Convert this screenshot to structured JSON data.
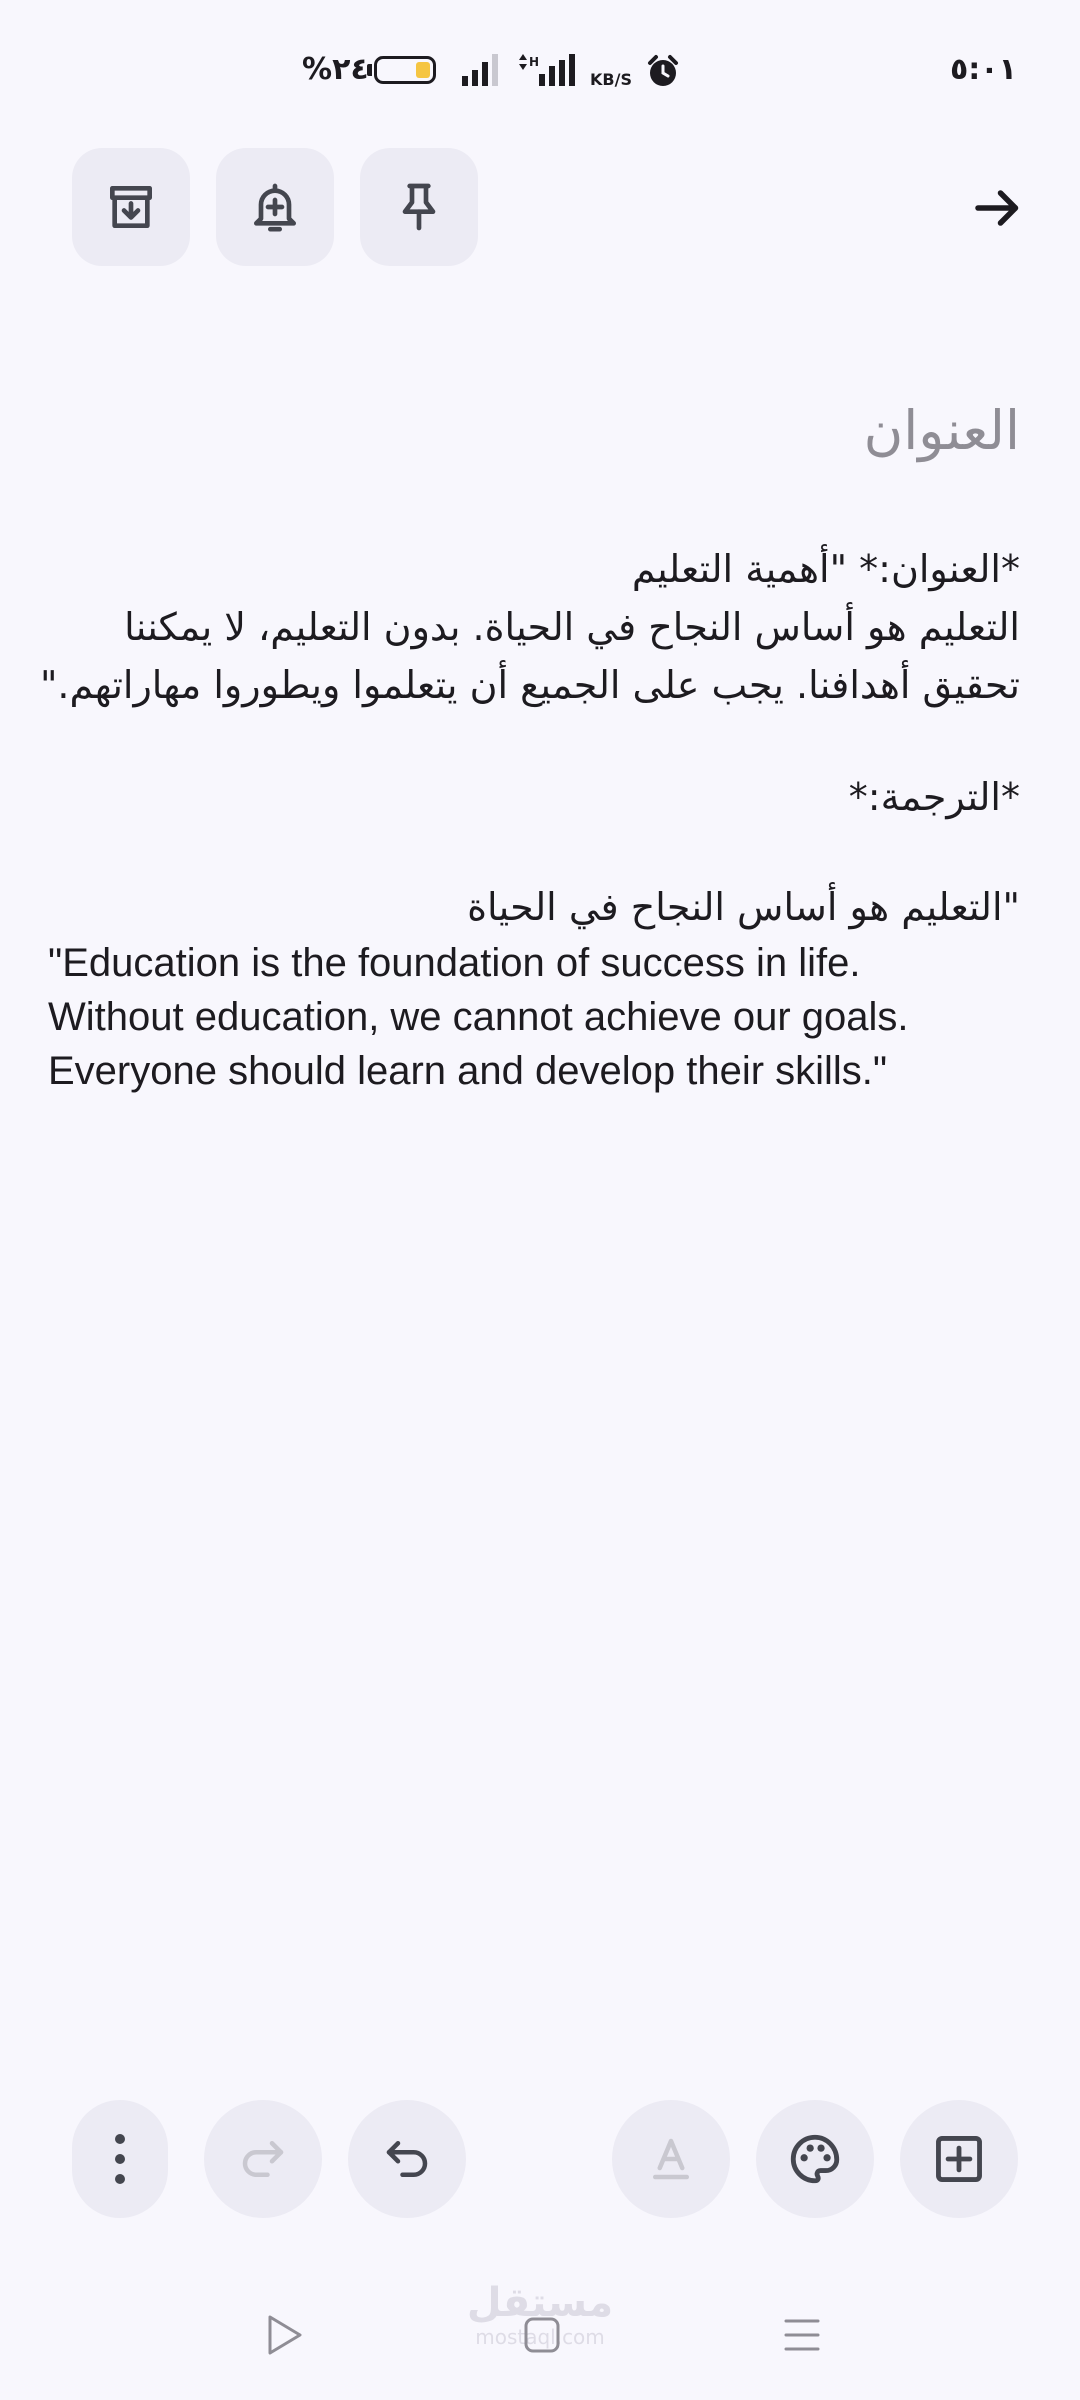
{
  "status_bar": {
    "time": "٥:٠١",
    "battery_percent": "%٢٤",
    "battery_level": 0.24,
    "network_speed_unit": "KB/S",
    "icons": [
      "battery-icon",
      "signal-icon",
      "signal-data-icon",
      "alarm-icon"
    ]
  },
  "toolbar": {
    "buttons": [
      {
        "name": "archive",
        "icon": "archive-icon"
      },
      {
        "name": "reminder",
        "icon": "add-reminder-bell-icon"
      },
      {
        "name": "pin",
        "icon": "pin-icon"
      }
    ],
    "back_icon": "arrow-right-icon"
  },
  "note": {
    "title_placeholder": "العنوان",
    "body": {
      "line1": "*العنوان:* \"أهمية التعليم",
      "line2": "التعليم هو أساس النجاح في الحياة. بدون التعليم، لا يمكننا",
      "line3": "تحقيق أهدافنا. يجب على الجميع أن يتعلموا ويطوروا مهاراتهم.\"",
      "line4": "*الترجمة:*",
      "line5": "\"التعليم هو أساس النجاح في الحياة",
      "english_line1": "\"Education is the foundation of success in life.",
      "english_line2": "Without education, we cannot achieve our goals.",
      "english_line3": "Everyone should learn and develop their skills.\""
    }
  },
  "bottom_toolbar": {
    "left": [
      {
        "name": "more",
        "icon": "more-vertical-icon"
      },
      {
        "name": "redo",
        "icon": "redo-icon",
        "disabled": true
      },
      {
        "name": "undo",
        "icon": "undo-icon"
      }
    ],
    "right": [
      {
        "name": "text-format",
        "icon": "text-format-icon",
        "disabled": true
      },
      {
        "name": "background",
        "icon": "palette-icon"
      },
      {
        "name": "add",
        "icon": "add-box-icon"
      }
    ]
  },
  "nav_bar": {
    "icons": [
      "nav-back-icon",
      "nav-home-icon",
      "nav-recents-icon"
    ]
  },
  "watermark": {
    "main": "مستقل",
    "sub": "mostaql.com"
  },
  "colors": {
    "background": "#f8f7fd",
    "button_bg": "#ecebf4",
    "icon": "#44464f",
    "icon_disabled": "#c9c8d0",
    "text": "#1d1b20",
    "placeholder": "#8f8d95",
    "battery_fill": "#f5c542"
  }
}
